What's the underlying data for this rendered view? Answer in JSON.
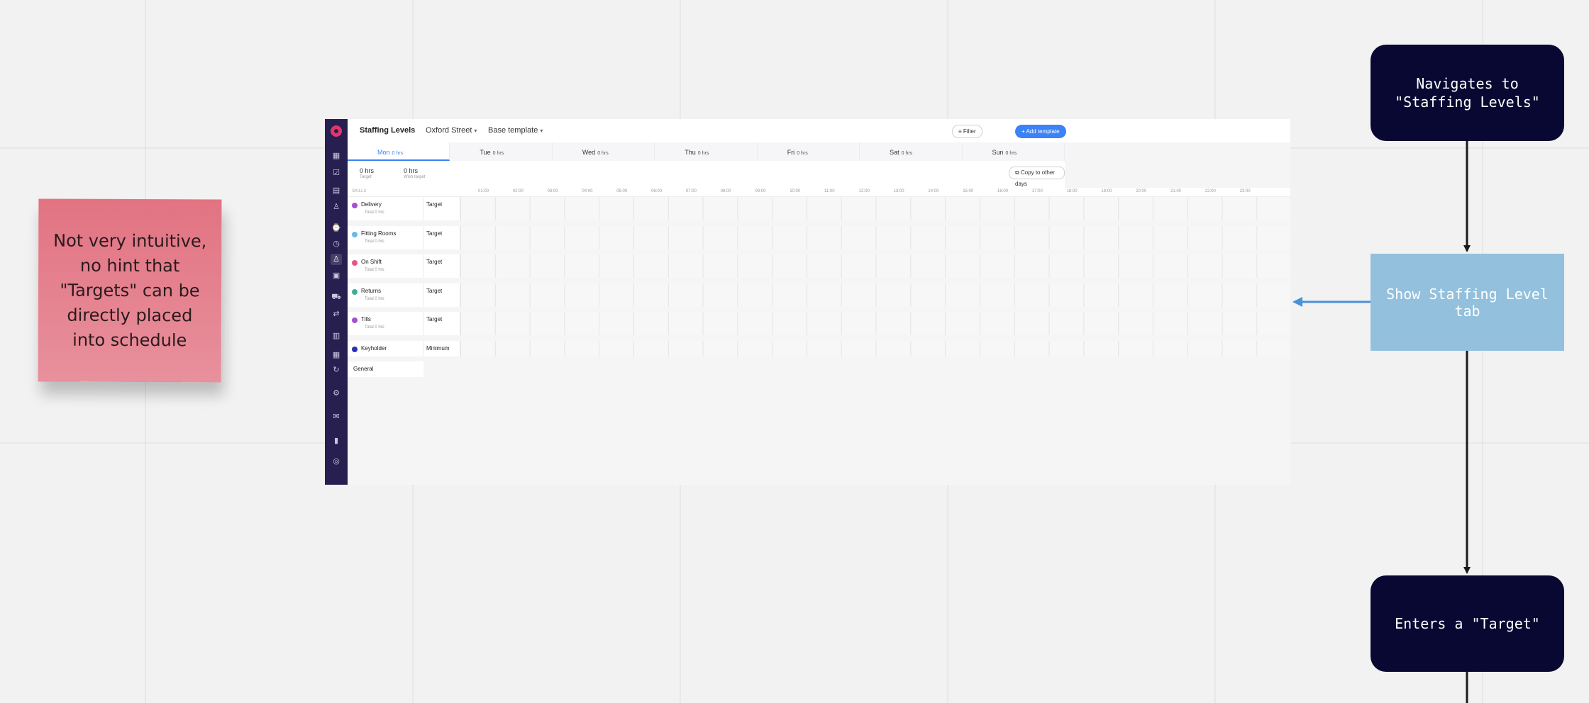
{
  "sticky_note": {
    "text": "Not very intuitive, no hint that \"Targets\" can be directly placed into schedule",
    "color": "#e27382"
  },
  "flow": {
    "step1": "Navigates to \"Staffing Levels\"",
    "step2": "Show Staffing Level tab",
    "step3": "Enters a \"Target\""
  },
  "app": {
    "title": "Staffing Levels",
    "location": "Oxford Street",
    "template": "Base template",
    "filter_label": "Filter",
    "add_template_label": "+ Add template",
    "days": [
      {
        "name": "Mon",
        "hrs": "0 hrs"
      },
      {
        "name": "Tue",
        "hrs": "0 hrs"
      },
      {
        "name": "Wed",
        "hrs": "0 hrs"
      },
      {
        "name": "Thu",
        "hrs": "0 hrs"
      },
      {
        "name": "Fri",
        "hrs": "0 hrs"
      },
      {
        "name": "Sat",
        "hrs": "0 hrs"
      },
      {
        "name": "Sun",
        "hrs": "0 hrs"
      }
    ],
    "active_day": "Mon",
    "summary": [
      {
        "value": "0 hrs",
        "label": "Target"
      },
      {
        "value": "0 hrs",
        "label": "Wish target"
      }
    ],
    "copy_label": "Copy to other days",
    "skills_header": "SKILLS",
    "hours": [
      "01:00",
      "02:00",
      "03:00",
      "04:00",
      "05:00",
      "06:00",
      "07:00",
      "08:00",
      "09:00",
      "10:00",
      "11:00",
      "12:00",
      "13:00",
      "14:00",
      "15:00",
      "16:00",
      "17:00",
      "18:00",
      "19:00",
      "20:00",
      "21:00",
      "22:00",
      "23:00"
    ],
    "skills": [
      {
        "name": "Delivery",
        "total": "Total 0 hrs",
        "type": "Target",
        "color": "#a64fcf"
      },
      {
        "name": "Fitting Rooms",
        "total": "Total 0 hrs",
        "type": "Target",
        "color": "#6cb9e6"
      },
      {
        "name": "On Shift",
        "total": "Total 0 hrs",
        "type": "Target",
        "color": "#e4578e"
      },
      {
        "name": "Returns",
        "total": "Total 0 hrs",
        "type": "Target",
        "color": "#3fae9e"
      },
      {
        "name": "Tills",
        "total": "Total 0 hrs",
        "type": "Target",
        "color": "#a64fcf"
      },
      {
        "name": "Keyholder",
        "total": "",
        "type": "Minimum",
        "color": "#2b2fb5"
      }
    ],
    "general_label": "General",
    "rail_icons": [
      "dashboard-icon",
      "schedule-icon",
      "clipboard-icon",
      "person-icon",
      "watch-icon",
      "clock-icon",
      "staffing-icon",
      "wallet-icon",
      "cart-icon",
      "swap-icon",
      "chart-icon",
      "calendar-icon",
      "sync-icon",
      "settings-icon",
      "mail-icon",
      "book-icon",
      "account-icon"
    ]
  }
}
